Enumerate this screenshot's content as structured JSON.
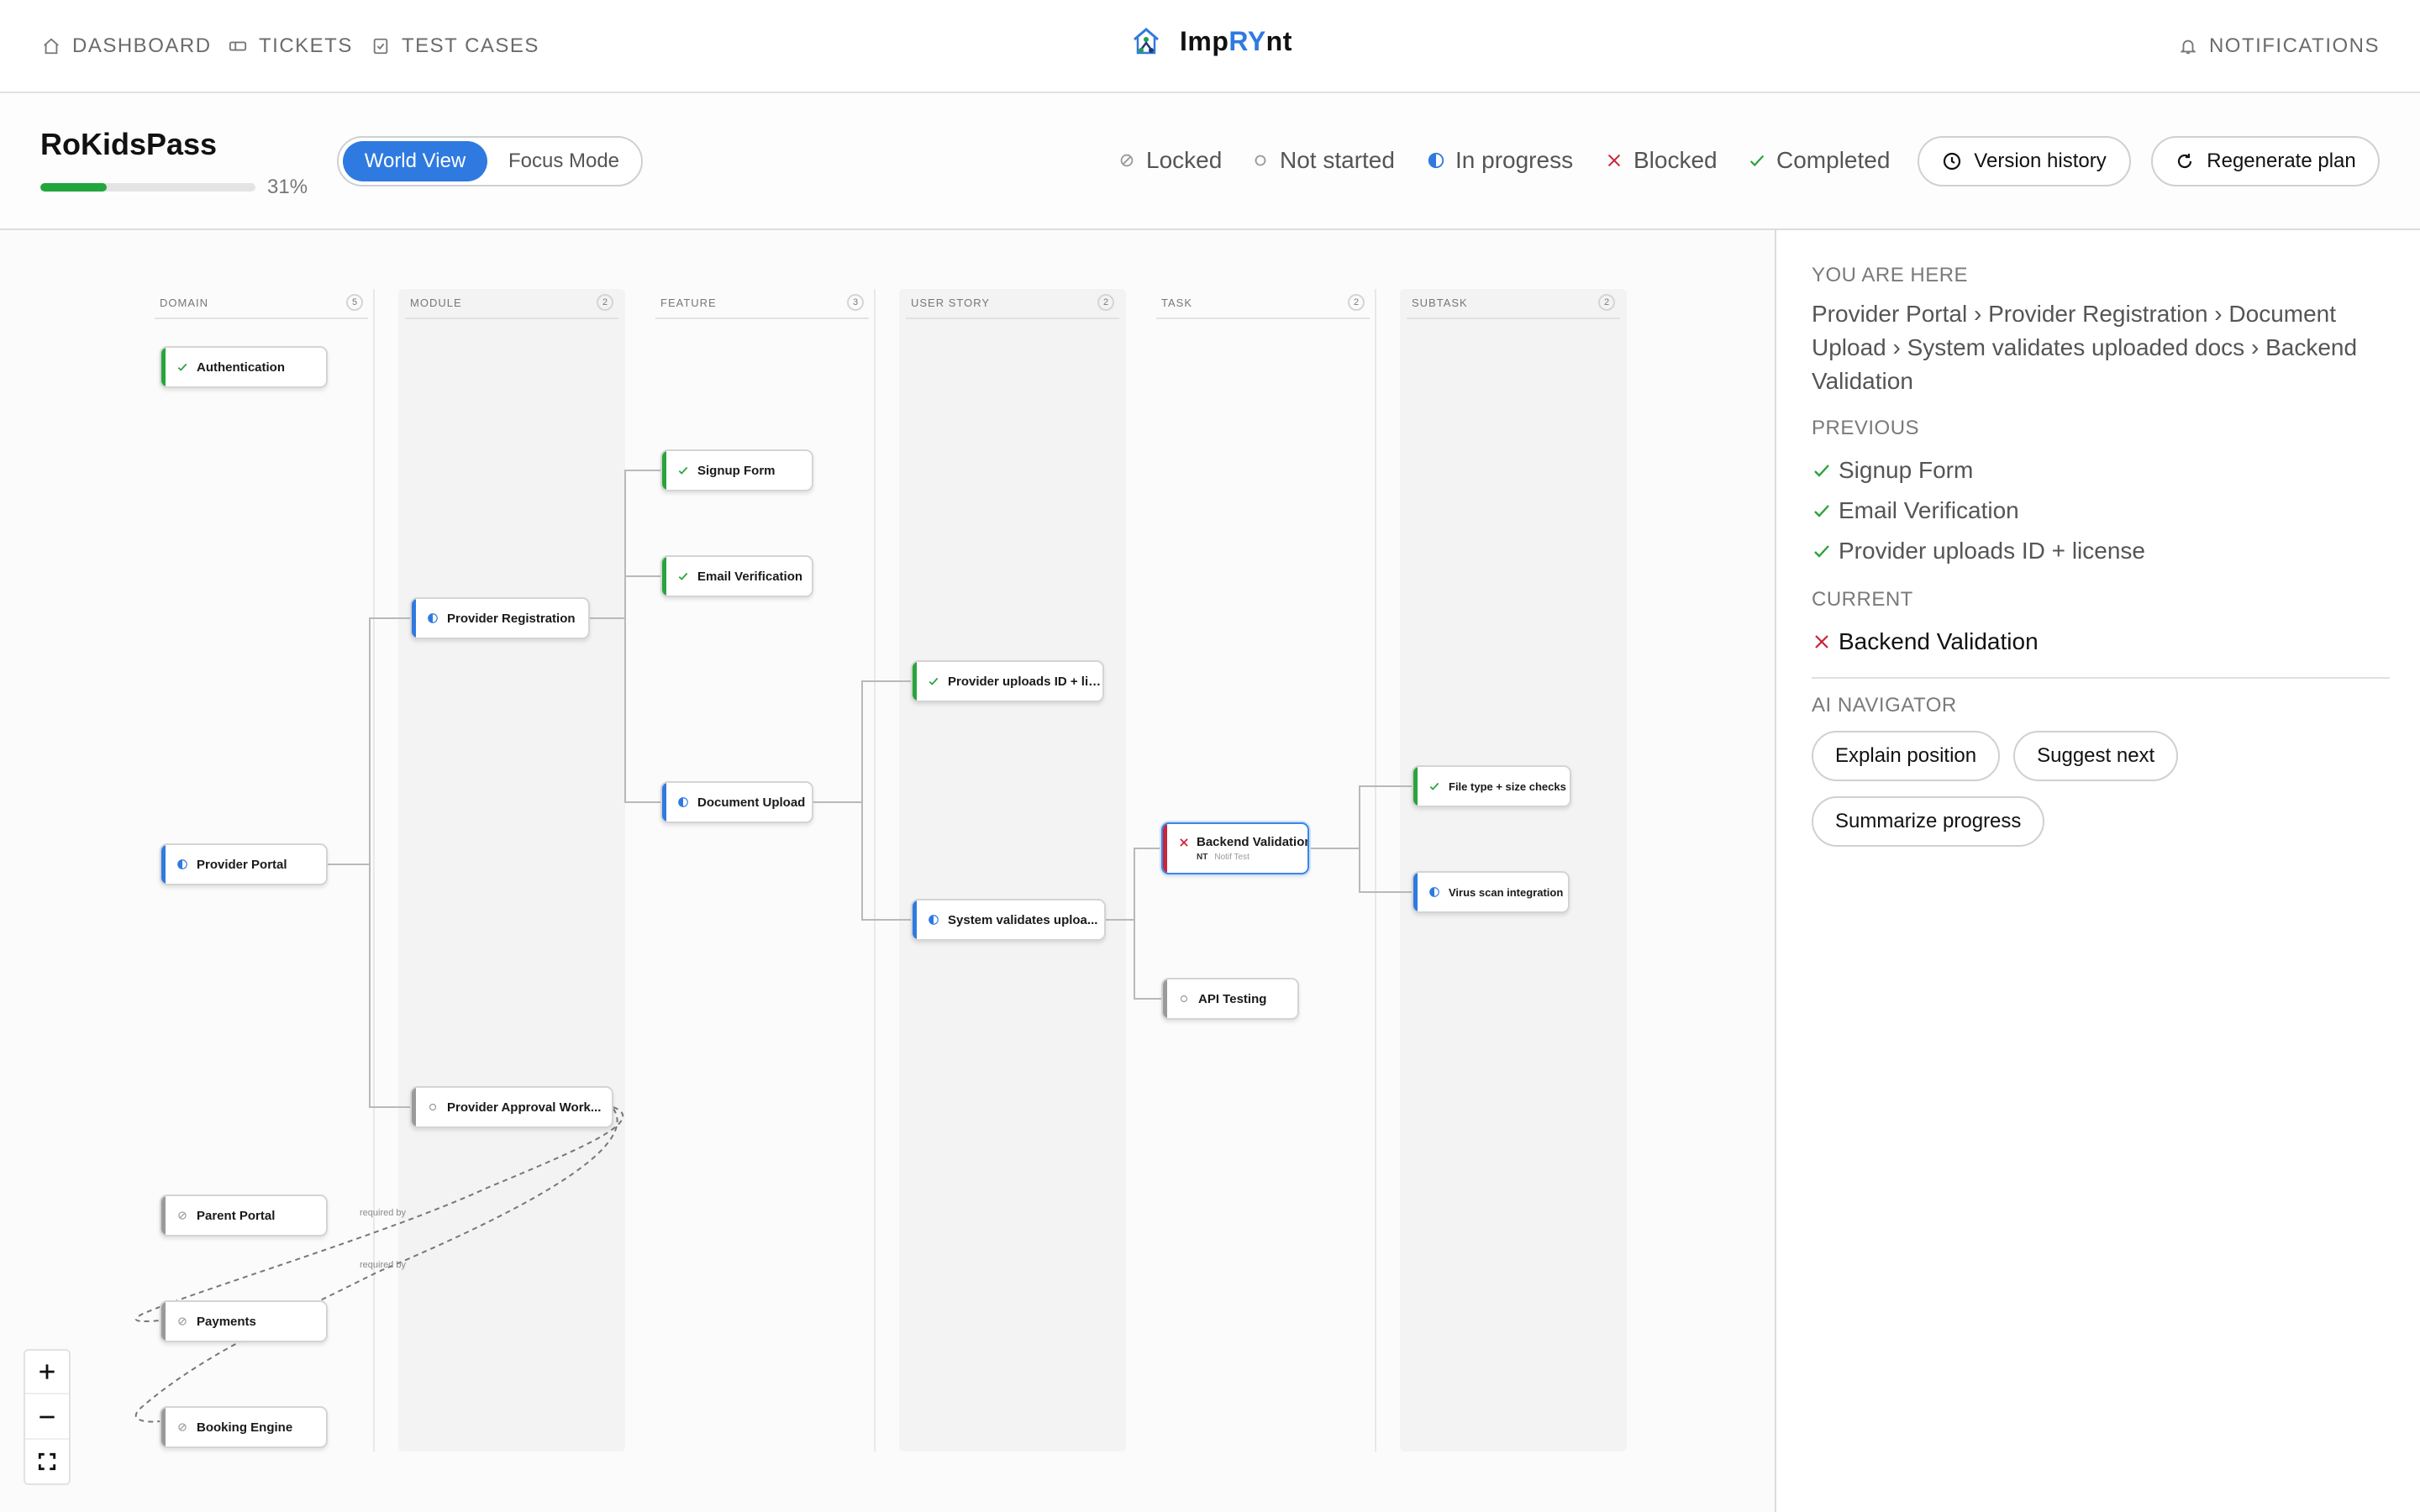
{
  "nav": {
    "dashboard": "DASHBOARD",
    "tickets": "TICKETS",
    "test_cases": "TEST CASES",
    "notifications": "NOTIFICATIONS",
    "brand_prefix": "Imp",
    "brand_highlight": "RY",
    "brand_suffix": "nt"
  },
  "header": {
    "project_name": "RoKidsPass",
    "progress_percent": 31,
    "progress_text": "31%",
    "view_modes": {
      "world": "World View",
      "focus": "Focus Mode",
      "selected": "World View"
    },
    "legend": {
      "locked": "Locked",
      "not_started": "Not started",
      "in_progress": "In progress",
      "blocked": "Blocked",
      "completed": "Completed"
    },
    "version_history": "Version history",
    "regenerate_plan": "Regenerate plan"
  },
  "columns": [
    {
      "title": "DOMAIN",
      "count": "5"
    },
    {
      "title": "MODULE",
      "count": "2"
    },
    {
      "title": "FEATURE",
      "count": "3"
    },
    {
      "title": "USER STORY",
      "count": "2"
    },
    {
      "title": "TASK",
      "count": "2"
    },
    {
      "title": "SUBTASK",
      "count": "2"
    }
  ],
  "nodes": {
    "authentication": {
      "label": "Authentication",
      "status": "completed"
    },
    "provider_portal": {
      "label": "Provider Portal",
      "status": "in_progress"
    },
    "parent_portal": {
      "label": "Parent Portal",
      "status": "locked"
    },
    "payments": {
      "label": "Payments",
      "status": "locked"
    },
    "booking_engine": {
      "label": "Booking Engine",
      "status": "locked"
    },
    "provider_registration": {
      "label": "Provider Registration",
      "status": "in_progress"
    },
    "provider_approval": {
      "label": "Provider Approval Work...",
      "status": "not_started"
    },
    "signup_form": {
      "label": "Signup Form",
      "status": "completed"
    },
    "email_verification": {
      "label": "Email Verification",
      "status": "completed"
    },
    "document_upload": {
      "label": "Document Upload",
      "status": "in_progress"
    },
    "provider_uploads": {
      "label": "Provider uploads ID + lic...",
      "status": "completed"
    },
    "system_validates": {
      "label": "System validates uploa...",
      "status": "in_progress"
    },
    "backend_validation": {
      "label": "Backend Validation",
      "status": "blocked",
      "tag": "NT",
      "sub": "Notif Test"
    },
    "api_testing": {
      "label": "API Testing",
      "status": "not_started"
    },
    "file_type_checks": {
      "label": "File type + size checks",
      "status": "completed"
    },
    "virus_scan": {
      "label": "Virus scan integration",
      "status": "in_progress"
    }
  },
  "edge_labels": {
    "required_by_1": "required by",
    "required_by_2": "required by"
  },
  "side_panel": {
    "you_are_here_heading": "YOU ARE HERE",
    "breadcrumb": "Provider Portal › Provider Registration › Document Upload › System validates uploaded docs › Backend Validation",
    "previous_heading": "PREVIOUS",
    "previous_items": [
      "Signup Form",
      "Email Verification",
      "Provider uploads ID + license"
    ],
    "current_heading": "CURRENT",
    "current_item": "Backend Validation",
    "ai_navigator_heading": "AI NAVIGATOR",
    "ai_actions": [
      "Explain position",
      "Suggest next",
      "Summarize progress"
    ]
  },
  "colors": {
    "accent": "#2f7ae0",
    "completed": "#2aa33c",
    "in_progress": "#2f7ae0",
    "blocked": "#c8243a",
    "locked": "#9a9a9a"
  },
  "icons": {
    "dashboard": "home-icon",
    "tickets": "ticket-icon",
    "test_cases": "clipboard-check-icon",
    "notifications": "bell-icon",
    "version_history": "clock-icon",
    "regenerate_plan": "refresh-icon"
  }
}
